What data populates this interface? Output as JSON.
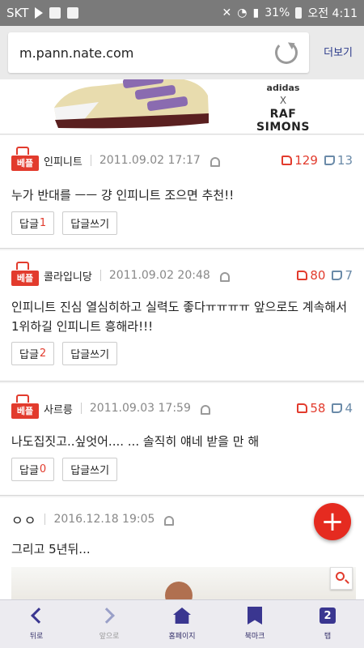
{
  "status_bar": {
    "carrier": "SKT",
    "battery": "31%",
    "time": "오전 4:11"
  },
  "browser": {
    "url": "m.pann.nate.com",
    "more_label": "더보기"
  },
  "banner": {
    "brand_top": "adidas",
    "brand_x": "X",
    "brand_bottom": "RAF SIMONS"
  },
  "comments": [
    {
      "badge": "베플",
      "nickname": "인피니트",
      "date": "2011.09.02 17:17",
      "up": "129",
      "down": "13",
      "text": "누가 반대를 ㅡㅡ 걍 인피니트 조으면 추천!!",
      "reply_label": "답글",
      "reply_count": "1",
      "write_reply_label": "답글쓰기"
    },
    {
      "badge": "베플",
      "nickname": "콜라입니당",
      "date": "2011.09.02 20:48",
      "up": "80",
      "down": "7",
      "text": "인피니트 진심 열심히하고 실력도 좋다ㅠㅠㅠㅠ 앞으로도 계속해서 1위하길 인피니트 흥해라!!!",
      "reply_label": "답글",
      "reply_count": "2",
      "write_reply_label": "답글쓰기"
    },
    {
      "badge": "베플",
      "nickname": "사르릉",
      "date": "2011.09.03 17:59",
      "up": "58",
      "down": "4",
      "text": "나도집짓고..싶엇어.... ... 솔직히 얘네 받을 만 해",
      "reply_label": "답글",
      "reply_count": "0",
      "write_reply_label": "답글쓰기"
    },
    {
      "nickname": "ㅇㅇ",
      "date": "2016.12.18 19:05",
      "text": "그리고 5년뒤..."
    }
  ],
  "fab": {
    "add_symbol": "+"
  },
  "nav": {
    "back": "뒤로",
    "forward": "앞으로",
    "home": "홈페이지",
    "bookmarks": "북마크",
    "tabs": "탭",
    "tab_count": "2"
  },
  "colors": {
    "accent_red": "#e23b2d",
    "nav_purple": "#3a3690",
    "status_bar": "#7a7a7a"
  }
}
